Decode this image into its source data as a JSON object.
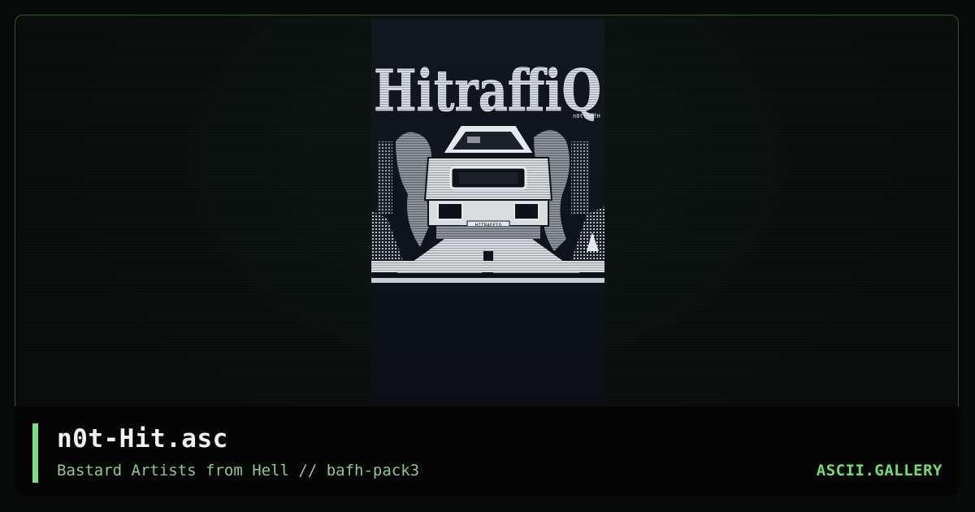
{
  "art": {
    "logo_text": "HitraffiQ",
    "signature": "n0t!BafH",
    "plate_text": "HITRAFFIQ"
  },
  "caption": {
    "title": "n0t-Hit.asc",
    "subtitle": "Bastard Artists from Hell // bafh-pack3",
    "brand": "ASCII.GALLERY"
  },
  "colors": {
    "accent": "#7be27b",
    "brand": "#6fe06f",
    "subtitle": "#8fc88f",
    "frame_border": "#2d5a2d"
  }
}
